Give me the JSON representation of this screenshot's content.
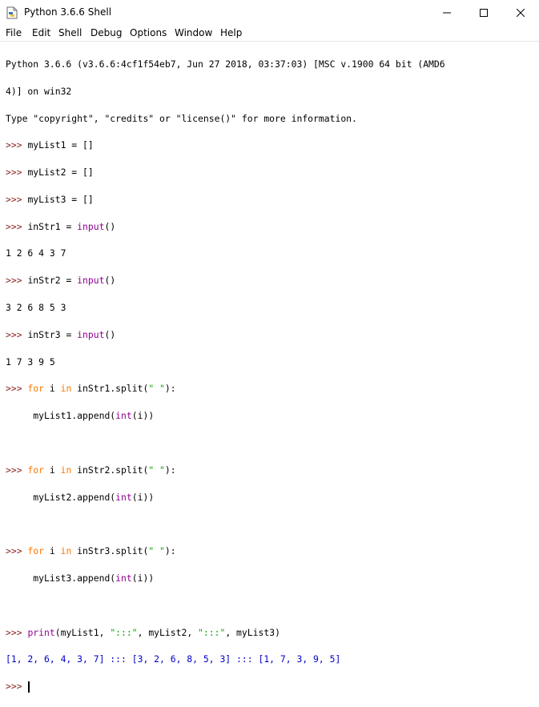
{
  "window": {
    "title": "Python 3.6.6 Shell"
  },
  "menu": [
    "File",
    "Edit",
    "Shell",
    "Debug",
    "Options",
    "Window",
    "Help"
  ],
  "prompt": ">>>",
  "banner": [
    "Python 3.6.6 (v3.6.6:4cf1f54eb7, Jun 27 2018, 03:37:03) [MSC v.1900 64 bit (AMD6",
    "4)] on win32",
    "Type \"copyright\", \"credits\" or \"license()\" for more information."
  ],
  "session": {
    "assign1": "myList1 = []",
    "assign2": "myList2 = []",
    "assign3": "myList3 = []",
    "in1_name": "inStr1 = ",
    "in2_name": "inStr2 = ",
    "in3_name": "inStr3 = ",
    "input_fn": "input",
    "parens": "()",
    "user_input_1": "1 2 6 4 3 7",
    "user_input_2": "3 2 6 8 5 3",
    "user_input_3": "1 7 3 9 5",
    "kw_for": "for",
    "var_i": " i ",
    "kw_in": "in",
    "split1": " inStr1.split(",
    "split2": " inStr2.split(",
    "split3": " inStr3.split(",
    "split_arg": "\" \"",
    "split_end": "):",
    "indent": "     ",
    "append1": "myList1.append(",
    "append2": "myList2.append(",
    "append3": "myList3.append(",
    "int_fn": "int",
    "append_end": "(i))",
    "print_fn": "print",
    "print_args_1": "(myList1, ",
    "sep": "\":::\"",
    "print_args_2": ", myList2, ",
    "print_args_3": ", myList3)",
    "output": "[1, 2, 6, 4, 3, 7] ::: [3, 2, 6, 8, 5, 3] ::: [1, 7, 3, 9, 5]"
  },
  "colors": {
    "prompt": "#8b2222",
    "keyword": "#ff7700",
    "builtin": "#900090",
    "string": "#00aa00",
    "stdout": "#0000cc"
  },
  "icons": [
    "python-file-icon",
    "minimize-icon",
    "maximize-icon",
    "close-icon"
  ]
}
